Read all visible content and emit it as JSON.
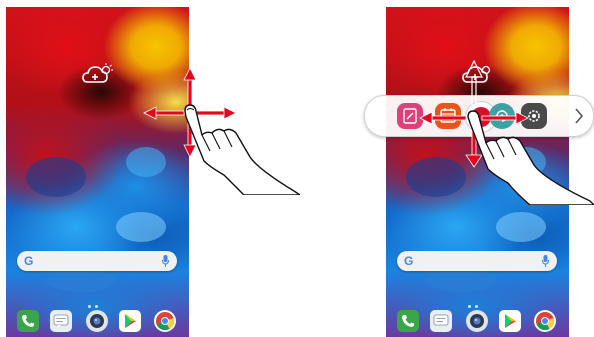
{
  "left_screen": {
    "search": {
      "logo": "G",
      "mic_icon": "mic-icon"
    },
    "weather_widget_icon": "weather-add-icon",
    "dock": [
      "phone-icon",
      "messages-icon",
      "camera-icon",
      "play-store-icon",
      "chrome-icon"
    ],
    "gesture": "drag-in-four-directions"
  },
  "right_screen": {
    "search": {
      "logo": "G",
      "mic_icon": "mic-icon"
    },
    "quick_bar": {
      "items": [
        "memo-icon",
        "calendar-icon",
        "record-icon",
        "capture-icon",
        "settings-icon"
      ],
      "more_icon": "chevron-right-icon"
    },
    "dock": [
      "phone-icon",
      "messages-icon",
      "camera-icon",
      "play-store-icon",
      "chrome-icon"
    ],
    "gesture": "drag-left-right-down"
  },
  "colors": {
    "arrow_red": "#e3061c",
    "memo_pink": "#e0407a",
    "calendar_orange": "#e8541c",
    "record_red": "#d6102a",
    "capture_teal": "#3ea2a4",
    "settings_dark": "#4a4a4a"
  }
}
